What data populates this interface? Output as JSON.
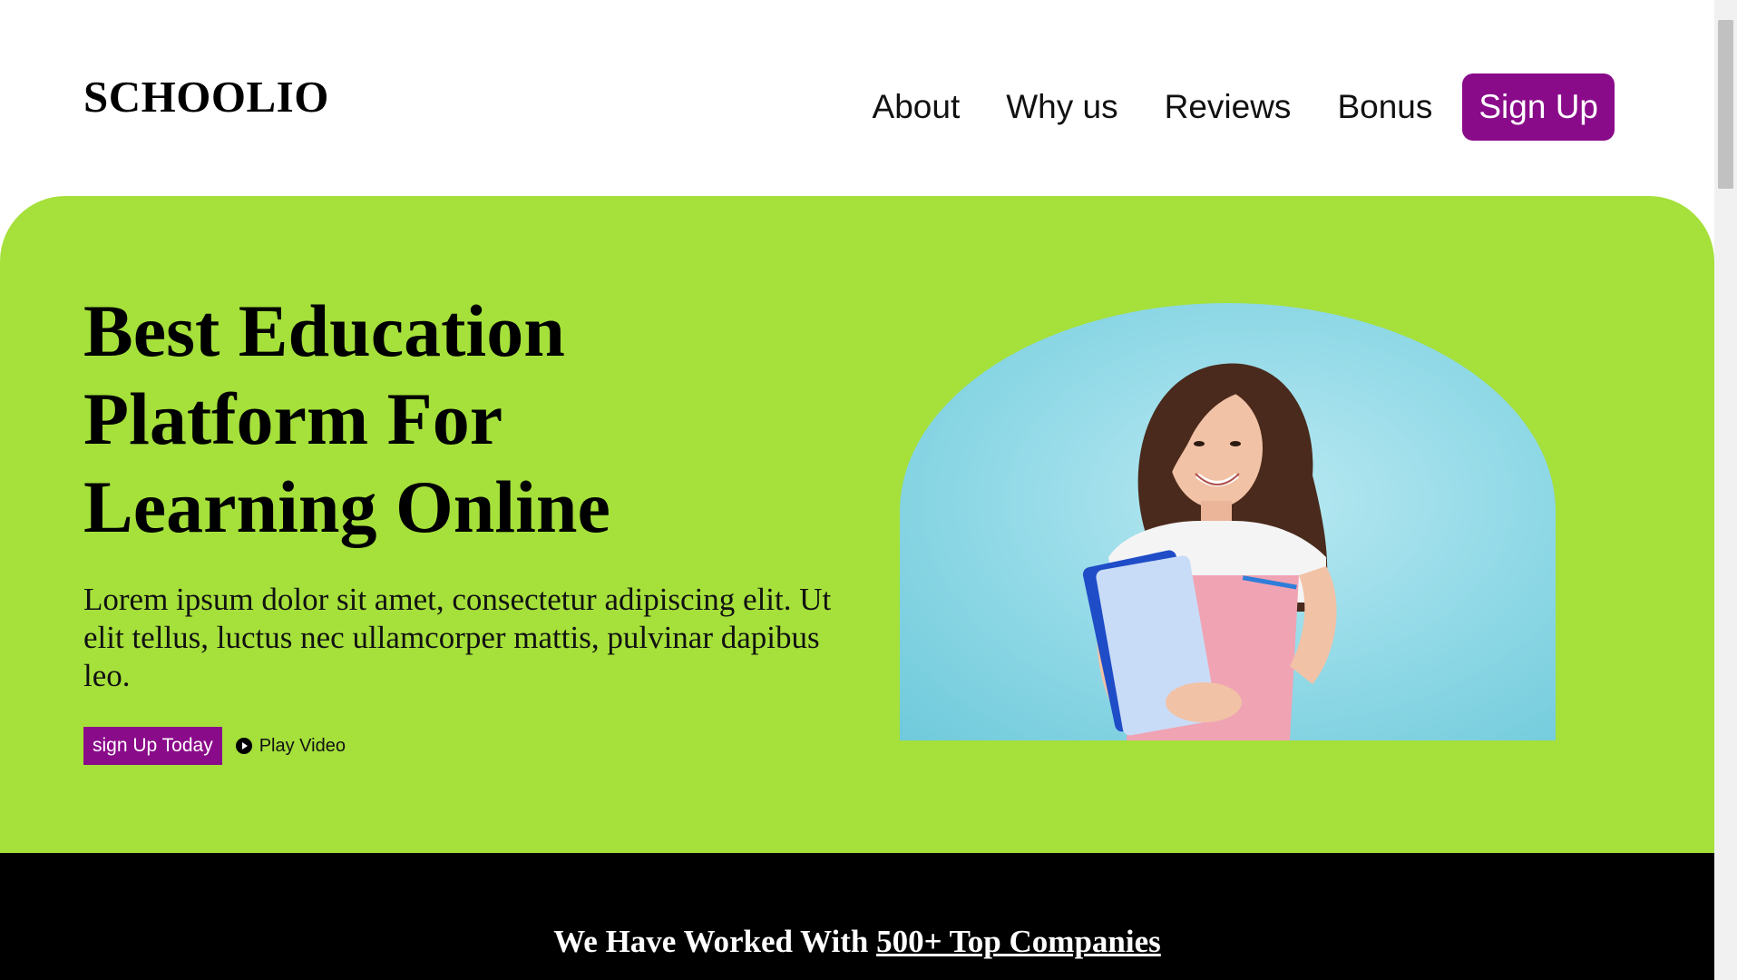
{
  "header": {
    "logo": "SCHOOLIO",
    "nav": [
      "About",
      "Why us",
      "Reviews",
      "Bonus"
    ],
    "cta": "Sign Up"
  },
  "hero": {
    "title_lines": [
      "Best Education",
      "Platform For",
      "Learning Online"
    ],
    "text": "Lorem ipsum dolor sit amet, consectetur adipiscing elit. Ut elit tellus, luctus nec ullamcorper mattis, pulvinar dapibus leo.",
    "primary_button": "sign Up Today",
    "secondary_button": "Play Video"
  },
  "companies": {
    "prefix": "We Have Worked With",
    "link": "500+ Top Companies"
  },
  "colors": {
    "accent": "#8a0b8a",
    "hero_bg": "#a5e03b",
    "dark_band": "#000000"
  }
}
